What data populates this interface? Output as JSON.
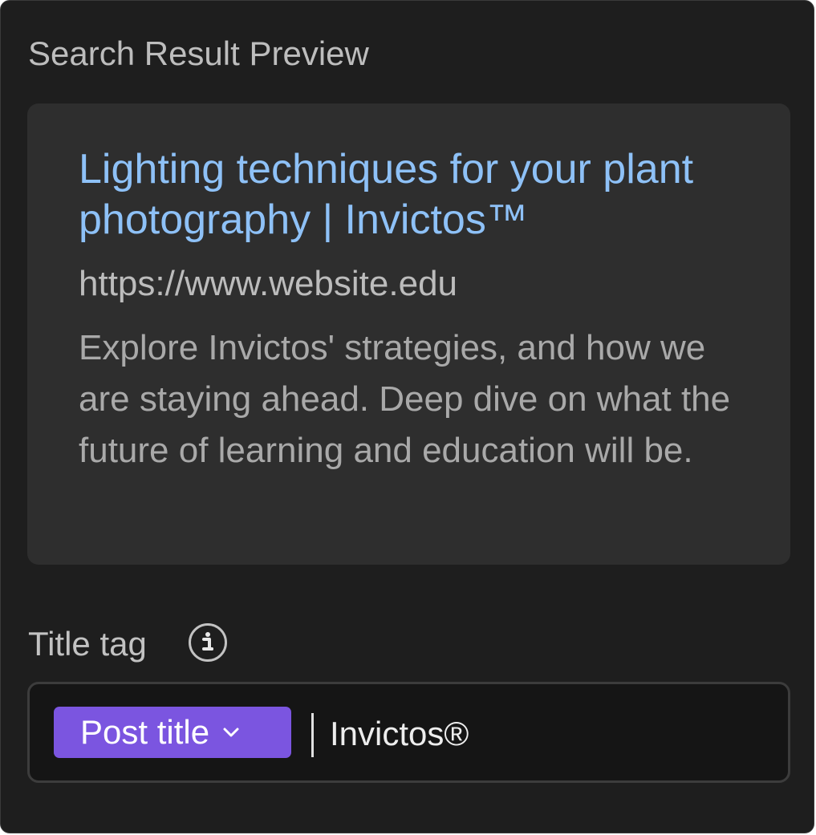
{
  "panel": {
    "heading": "Search Result Preview"
  },
  "preview": {
    "title": "Lighting techniques for your plant photography | Invictos™",
    "url": "https://www.website.edu",
    "description": "Explore Invictos' strategies, and how we are staying ahead. Deep dive on what the future of learning and education will be."
  },
  "title_tag": {
    "label": "Title tag",
    "info_icon": "info-icon",
    "token_label": "Post title",
    "token_icon": "chevron-down-icon",
    "value": "Invictos®"
  },
  "colors": {
    "panel_bg": "#1e1e1e",
    "card_bg": "#2e2e2e",
    "link_blue": "#8ec1f7",
    "token_purple": "#7b55e0"
  }
}
